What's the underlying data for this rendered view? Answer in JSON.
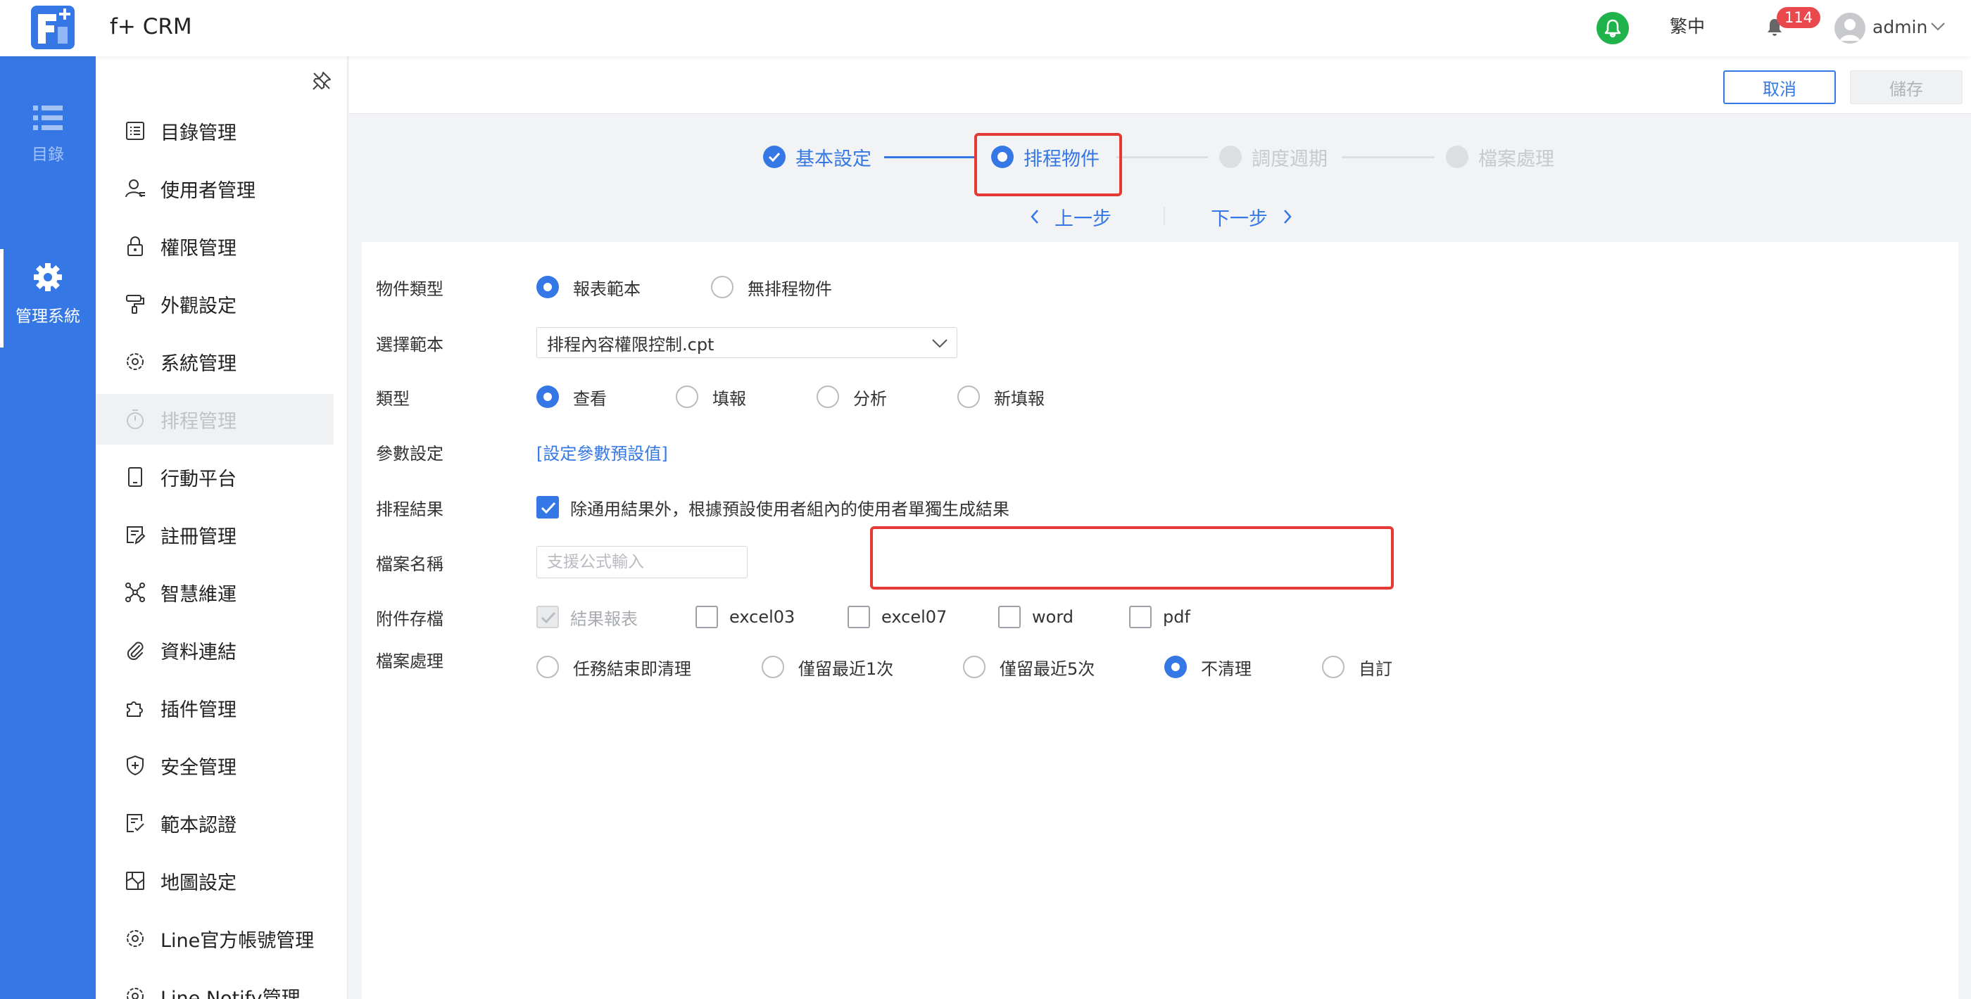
{
  "app": {
    "title": "f+ CRM"
  },
  "header": {
    "language": "繁中",
    "notification_count": "114",
    "user": "admin"
  },
  "rail": [
    {
      "label": "目錄",
      "icon": "list-icon"
    },
    {
      "label": "管理系統",
      "icon": "gear-icon"
    }
  ],
  "submenu": [
    {
      "label": "目錄管理",
      "icon": "catalog-icon"
    },
    {
      "label": "使用者管理",
      "icon": "user-icon"
    },
    {
      "label": "權限管理",
      "icon": "lock-icon"
    },
    {
      "label": "外觀設定",
      "icon": "paint-roller-icon"
    },
    {
      "label": "系統管理",
      "icon": "cog-icon"
    },
    {
      "label": "排程管理",
      "icon": "timer-icon"
    },
    {
      "label": "行動平台",
      "icon": "tablet-icon"
    },
    {
      "label": "註冊管理",
      "icon": "register-icon"
    },
    {
      "label": "智慧維運",
      "icon": "network-icon"
    },
    {
      "label": "資料連結",
      "icon": "paperclip-icon"
    },
    {
      "label": "插件管理",
      "icon": "puzzle-icon"
    },
    {
      "label": "安全管理",
      "icon": "shield-icon"
    },
    {
      "label": "範本認證",
      "icon": "template-cert-icon"
    },
    {
      "label": "地圖設定",
      "icon": "map-icon"
    },
    {
      "label": "Line官方帳號管理",
      "icon": "cog-icon"
    },
    {
      "label": "Line Notify管理",
      "icon": "cog-icon"
    }
  ],
  "actions": {
    "cancel": "取消",
    "save": "儲存"
  },
  "steps": [
    {
      "label": "基本設定",
      "state": "done"
    },
    {
      "label": "排程物件",
      "state": "current"
    },
    {
      "label": "調度週期",
      "state": "todo"
    },
    {
      "label": "檔案處理",
      "state": "todo"
    }
  ],
  "nav": {
    "prev": "上一步",
    "next": "下一步"
  },
  "form": {
    "object_type": {
      "label": "物件類型",
      "options": [
        "報表範本",
        "無排程物件"
      ],
      "selected": 0
    },
    "template": {
      "label": "選擇範本",
      "value": "排程內容權限控制.cpt"
    },
    "type": {
      "label": "類型",
      "options": [
        "查看",
        "填報",
        "分析",
        "新填報"
      ],
      "selected": 0
    },
    "params": {
      "label": "參數設定",
      "link": "[設定參數預設值]"
    },
    "result": {
      "label": "排程結果",
      "checkbox_label": "除通用結果外，根據預設使用者組內的使用者單獨生成結果",
      "checked": true
    },
    "file_name": {
      "label": "檔案名稱",
      "placeholder": "支援公式輸入",
      "value": ""
    },
    "attachment": {
      "label": "附件存檔",
      "options": [
        "結果報表",
        "excel03",
        "excel07",
        "word",
        "pdf"
      ],
      "checked": [
        true,
        false,
        false,
        false,
        false
      ]
    },
    "file_handling": {
      "label": "檔案處理",
      "options": [
        "任務結束即清理",
        "僅留最近1次",
        "僅留最近5次",
        "不清理",
        "自訂"
      ],
      "selected": 3
    }
  },
  "colors": {
    "accent": "#3578e5",
    "highlight": "#e53935",
    "success": "#21b34b",
    "badge": "#e9494d"
  }
}
